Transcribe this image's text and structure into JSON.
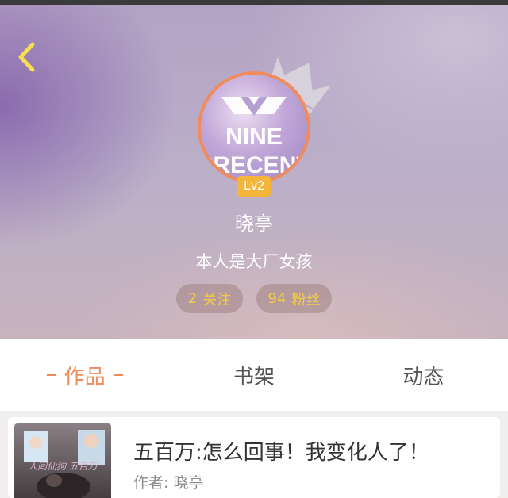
{
  "profile": {
    "username": "晓亭",
    "bio": "本人是大厂女孩",
    "level_badge": "Lv2",
    "avatar_text_line1": "NINE",
    "avatar_text_line2": "PRECENT",
    "stats": {
      "following_count": "2",
      "following_label": "关注",
      "fans_count": "94",
      "fans_label": "粉丝"
    }
  },
  "tabs": [
    {
      "label": "作品",
      "active": true
    },
    {
      "label": "书架",
      "active": false
    },
    {
      "label": "动态",
      "active": false
    }
  ],
  "works": [
    {
      "title": "五百万:怎么回事！我变化人了！",
      "author": "作者: 晓亭",
      "cover_text": "人间仙狗 五百万"
    }
  ],
  "colors": {
    "accent": "#ef8a5a",
    "stat_text": "#f4cc46",
    "badge": "#f3b63a",
    "avatar_border": "#f08c5b"
  },
  "icons": {
    "back": "chevron-left-icon",
    "crown": "crown-icon"
  }
}
